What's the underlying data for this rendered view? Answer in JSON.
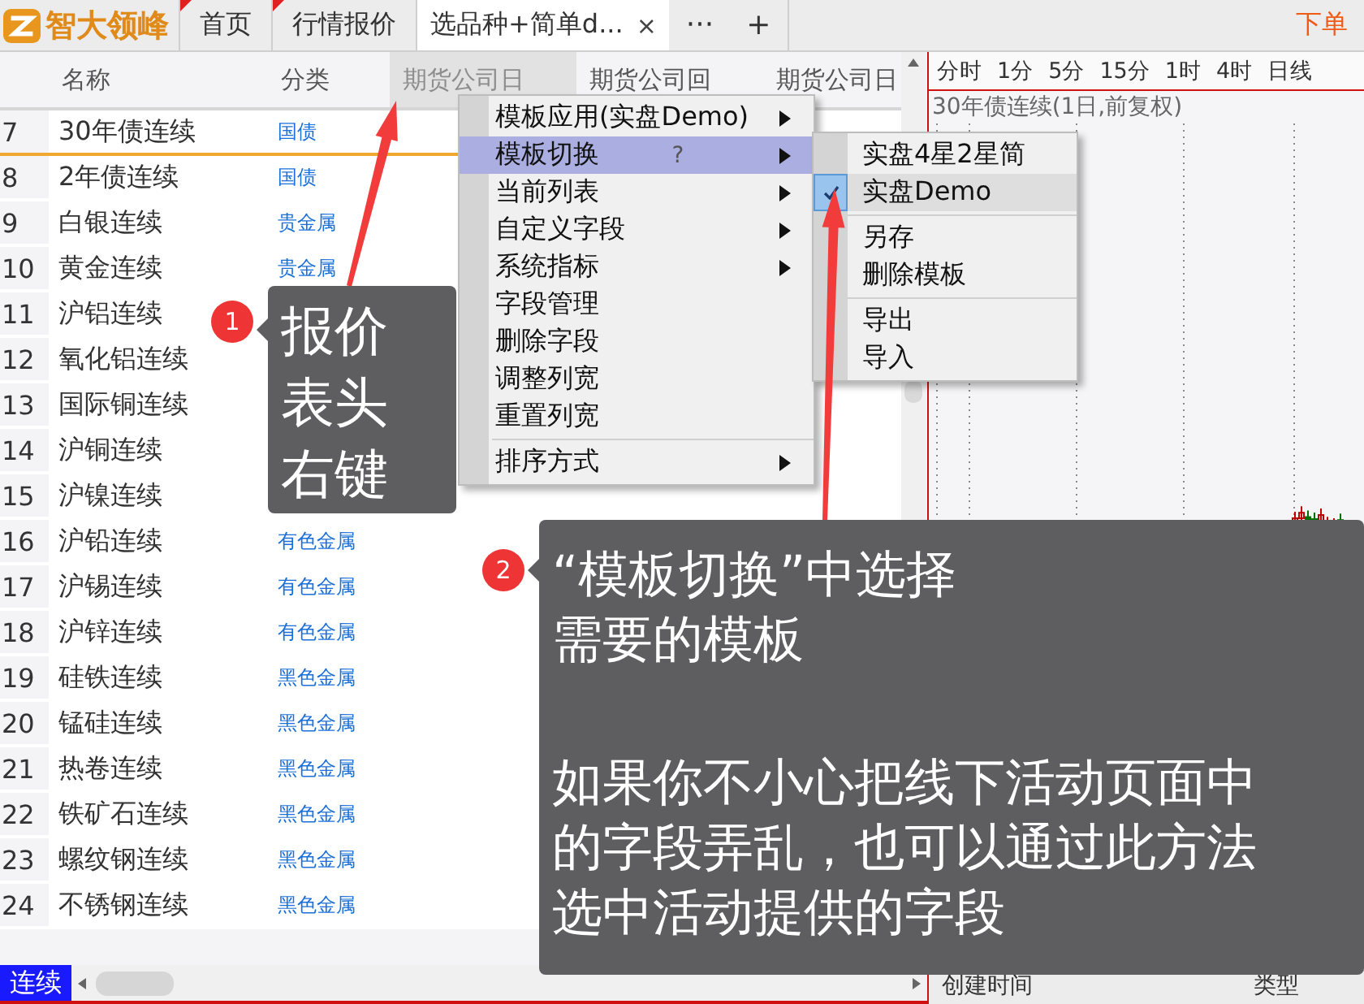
{
  "app": {
    "logo_text": "智大领峰"
  },
  "tabs": [
    {
      "label": "首页",
      "selected": false,
      "marked": true
    },
    {
      "label": "行情报价",
      "selected": false,
      "marked": true
    },
    {
      "label": "选品种+简单d...",
      "selected": true,
      "marked": false,
      "close": "×"
    }
  ],
  "tab_more": "···",
  "tab_add": "+",
  "order_button": "下单",
  "quote_table": {
    "columns": [
      {
        "label": "名称",
        "highlighted": false
      },
      {
        "label": "分类",
        "highlighted": false
      },
      {
        "label": "期货公司日",
        "highlighted": true
      },
      {
        "label": "期货公司回",
        "highlighted": false
      },
      {
        "label": "期货公司日",
        "highlighted": false
      }
    ],
    "rows": [
      {
        "index": "7",
        "name": "30年债连续",
        "category": "国债",
        "selected": true
      },
      {
        "index": "8",
        "name": "2年债连续",
        "category": "国债",
        "selected": false
      },
      {
        "index": "9",
        "name": "白银连续",
        "category": "贵金属",
        "selected": false
      },
      {
        "index": "10",
        "name": "黄金连续",
        "category": "贵金属",
        "selected": false
      },
      {
        "index": "11",
        "name": "沪铝连续",
        "selected": false
      },
      {
        "index": "12",
        "name": "氧化铝连续",
        "selected": false
      },
      {
        "index": "13",
        "name": "国际铜连续",
        "selected": false
      },
      {
        "index": "14",
        "name": "沪铜连续",
        "selected": false
      },
      {
        "index": "15",
        "name": "沪镍连续",
        "selected": false
      },
      {
        "index": "16",
        "name": "沪铅连续",
        "category": "有色金属",
        "selected": false
      },
      {
        "index": "17",
        "name": "沪锡连续",
        "category": "有色金属",
        "selected": false
      },
      {
        "index": "18",
        "name": "沪锌连续",
        "category": "有色金属",
        "selected": false
      },
      {
        "index": "19",
        "name": "硅铁连续",
        "category": "黑色金属",
        "selected": false
      },
      {
        "index": "20",
        "name": "锰硅连续",
        "category": "黑色金属",
        "selected": false
      },
      {
        "index": "21",
        "name": "热卷连续",
        "category": "黑色金属",
        "selected": false
      },
      {
        "index": "22",
        "name": "铁矿石连续",
        "category": "黑色金属",
        "selected": false
      },
      {
        "index": "23",
        "name": "螺纹钢连续",
        "category": "黑色金属",
        "selected": false
      },
      {
        "index": "24",
        "name": "不锈钢连续",
        "category": "黑色金属",
        "selected": false
      }
    ]
  },
  "sheet_tab": {
    "label": "连续",
    "selected": true
  },
  "chart": {
    "periods": [
      "分时",
      "1分",
      "5分",
      "15分",
      "1时",
      "4时",
      "日线"
    ],
    "title": "30年债连续(1日,前复权)",
    "bottom_columns": [
      "创建时间",
      "类型"
    ]
  },
  "context_menu": {
    "items": [
      {
        "kind": "item",
        "label": "模板应用(实盘Demo)",
        "submenu": true,
        "highlighted": false
      },
      {
        "kind": "item",
        "label": "模板切换",
        "hint": "?",
        "submenu": true,
        "highlighted": true
      },
      {
        "kind": "item",
        "label": "当前列表",
        "submenu": true,
        "highlighted": false
      },
      {
        "kind": "item",
        "label": "自定义字段",
        "submenu": true,
        "highlighted": false
      },
      {
        "kind": "item",
        "label": "系统指标",
        "submenu": true,
        "highlighted": false
      },
      {
        "kind": "item",
        "label": "字段管理",
        "submenu": false,
        "highlighted": false
      },
      {
        "kind": "item",
        "label": "删除字段",
        "submenu": false,
        "highlighted": false
      },
      {
        "kind": "item",
        "label": "调整列宽",
        "submenu": false,
        "highlighted": false
      },
      {
        "kind": "item",
        "label": "重置列宽",
        "submenu": false,
        "highlighted": false
      },
      {
        "kind": "separator"
      },
      {
        "kind": "item",
        "label": "排序方式",
        "submenu": true,
        "highlighted": false
      }
    ]
  },
  "submenu": {
    "items": [
      {
        "kind": "item",
        "label": "实盘4星2星简",
        "checked": false,
        "highlighted": false
      },
      {
        "kind": "item",
        "label": "实盘Demo",
        "checked": true,
        "highlighted": true
      },
      {
        "kind": "separator"
      },
      {
        "kind": "item",
        "label": "另存",
        "checked": false,
        "highlighted": false
      },
      {
        "kind": "item",
        "label": "删除模板",
        "checked": false,
        "highlighted": false
      },
      {
        "kind": "separator"
      },
      {
        "kind": "item",
        "label": "导出",
        "checked": false,
        "highlighted": false
      },
      {
        "kind": "item",
        "label": "导入",
        "checked": false,
        "highlighted": false
      }
    ]
  },
  "annotations": [
    {
      "badge": "1",
      "paragraphs": [
        [
          "报价",
          "表头",
          "右键"
        ]
      ]
    },
    {
      "badge": "2",
      "paragraphs": [
        [
          "“模板切换”中选择",
          "需要的模板"
        ],
        [
          "如果你不小心把线下活动页面中",
          "的字段弄乱，也可以通过此方法",
          "选中活动提供的字段"
        ]
      ]
    }
  ]
}
